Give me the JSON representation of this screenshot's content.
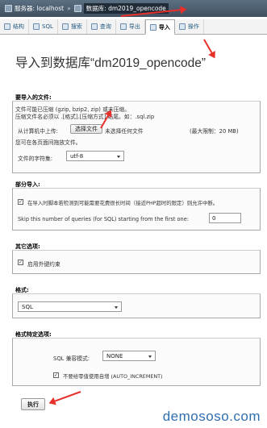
{
  "breadcrumb": {
    "server": "服务器: localhost",
    "separator": "»",
    "database": "数据库: dm2019_opencode"
  },
  "tabs": [
    {
      "label": "结构",
      "icon": "structure-icon"
    },
    {
      "label": "SQL",
      "icon": "sql-icon"
    },
    {
      "label": "搜索",
      "icon": "search-icon"
    },
    {
      "label": "查询",
      "icon": "query-icon"
    },
    {
      "label": "导出",
      "icon": "export-icon"
    },
    {
      "label": "导入",
      "icon": "import-icon",
      "active": true
    },
    {
      "label": "操作",
      "icon": "wrench-icon"
    }
  ],
  "title": "导入到数据库“dm2019_opencode”",
  "file_section": {
    "legend": "要导入的文件:",
    "note1": "文件可能已压缩 (gzip, bzip2, zip) 或未压缩。",
    "note2": "压缩文件名必须以 .[格式].[压缩方式] 结尾。如：.sql.zip",
    "upload_label": "从计算机中上传:",
    "choose_button": "选择文件",
    "no_file": "未选择任何文件",
    "max_size": "(最大限制：20 MB)",
    "drag_hint": "您可在各页面间拖放文件。",
    "charset_label": "文件的字符集:",
    "charset_value": "utf-8"
  },
  "partial_section": {
    "legend": "部分导入:",
    "interrupt_label": "在导入时脚本若检测到可能需要花费很长时间（接近PHP超时的限定）则允许中断。",
    "skip_label": "Skip this number of queries (for SQL) starting from the first one:",
    "skip_value": "0"
  },
  "other_section": {
    "legend": "其它选项:",
    "fk_label": "启用外键约束"
  },
  "format_section": {
    "legend": "格式:",
    "format_value": "SQL"
  },
  "format_options_section": {
    "legend": "格式特定选项:",
    "compat_label": "SQL 兼容模式:",
    "compat_value": "NONE",
    "auto_increment_label": "不要给零值使用自增 (AUTO_INCREMENT)"
  },
  "go_button": "执行",
  "watermark": "demososo.com",
  "colors": {
    "annotation_arrow": "#e8302b",
    "tab_link": "#235a81"
  }
}
